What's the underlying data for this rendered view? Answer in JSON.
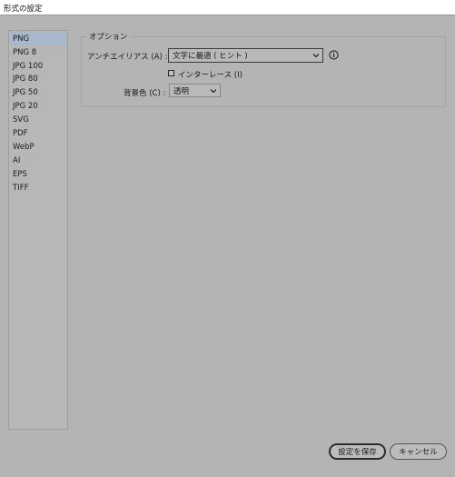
{
  "window": {
    "title": "形式の設定"
  },
  "sidebar": {
    "items": [
      {
        "label": "PNG",
        "selected": true
      },
      {
        "label": "PNG 8",
        "selected": false
      },
      {
        "label": "JPG 100",
        "selected": false
      },
      {
        "label": "JPG 80",
        "selected": false
      },
      {
        "label": "JPG 50",
        "selected": false
      },
      {
        "label": "JPG 20",
        "selected": false
      },
      {
        "label": "SVG",
        "selected": false
      },
      {
        "label": "PDF",
        "selected": false
      },
      {
        "label": "WebP",
        "selected": false
      },
      {
        "label": "AI",
        "selected": false
      },
      {
        "label": "EPS",
        "selected": false
      },
      {
        "label": "TIFF",
        "selected": false
      }
    ],
    "selected_color": "#a7b7cc"
  },
  "options": {
    "group_label": "オプション",
    "antialias": {
      "label": "アンチエイリアス (A) :",
      "value": "文字に最適 ( ヒント )",
      "icon": "chevron-down-icon"
    },
    "info_icon": "info-icon",
    "interlace": {
      "label": "インターレース (I)",
      "checked": false
    },
    "background": {
      "label": "背景色 (C) :",
      "value": "透明",
      "icon": "chevron-down-icon"
    }
  },
  "footer": {
    "save_label": "設定を保存",
    "cancel_label": "キャンセル"
  },
  "colors": {
    "background": "#b4b4b4",
    "titlebar": "#ffffff"
  }
}
